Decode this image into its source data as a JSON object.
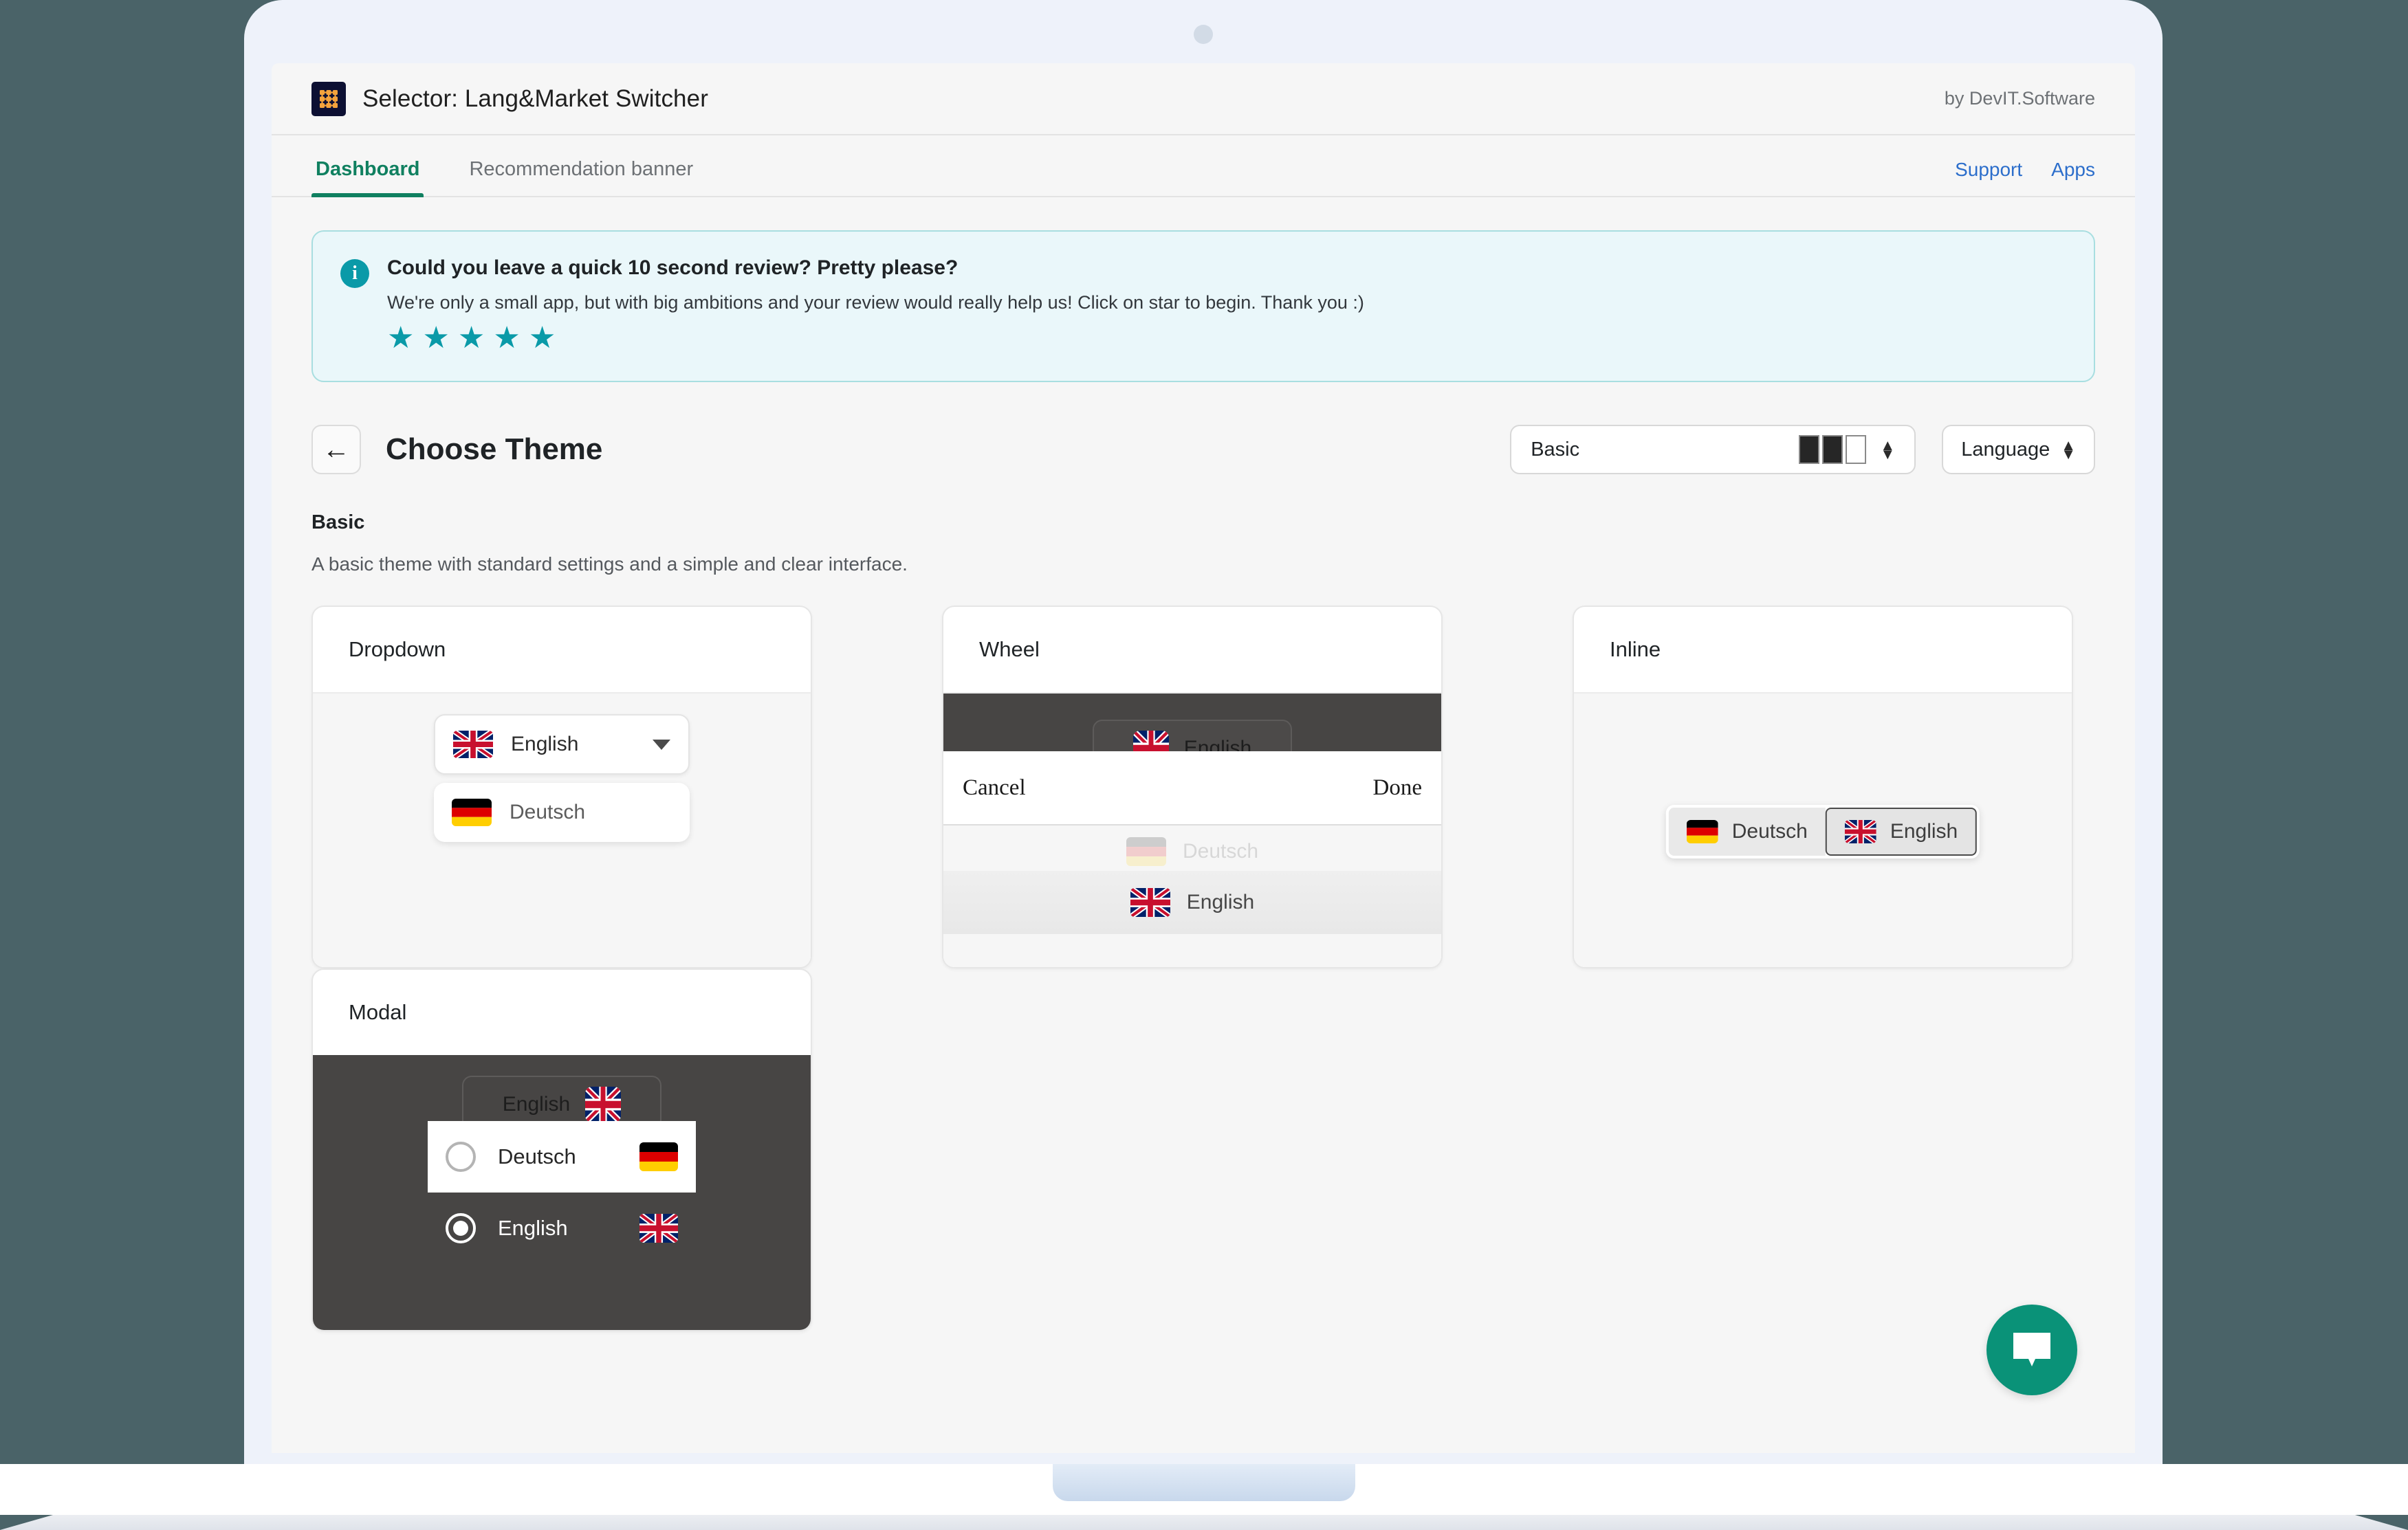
{
  "app": {
    "logo_icon": "grid-dots-icon",
    "title": "Selector: Lang&Market Switcher",
    "vendor": "by DevIT.Software"
  },
  "nav": {
    "tabs": [
      {
        "label": "Dashboard",
        "active": true
      },
      {
        "label": "Recommendation banner",
        "active": false
      }
    ],
    "links": [
      {
        "label": "Support"
      },
      {
        "label": "Apps"
      }
    ]
  },
  "review_banner": {
    "icon": "info-icon",
    "icon_glyph": "i",
    "title": "Could you leave a quick 10 second review? Pretty please?",
    "body": "We're only a small app, but with big ambitions and your review would really help us! Click on star to begin. Thank you :)",
    "stars": [
      "★",
      "★",
      "★",
      "★",
      "★"
    ],
    "star_color": "#0a9aa8"
  },
  "theme_header": {
    "back_icon": "arrow-left-icon",
    "back_glyph": "←",
    "title": "Choose Theme",
    "theme_select": {
      "value": "Basic",
      "swatches": [
        "#262626",
        "#262626",
        "#ffffff"
      ],
      "spinner_up": "▲",
      "spinner_down": "▼"
    },
    "language_select": {
      "value": "Language",
      "spinner_up": "▲",
      "spinner_down": "▼"
    }
  },
  "basic_section": {
    "name": "Basic",
    "description": "A basic theme with standard settings and a simple and clear interface."
  },
  "cards": {
    "dropdown": {
      "title": "Dropdown",
      "trigger_label": "English",
      "trigger_flag": "flag-uk",
      "caret_icon": "chevron-down-icon",
      "option_label": "Deutsch",
      "option_flag": "flag-de"
    },
    "wheel": {
      "title": "Wheel",
      "chip_label": "English",
      "chip_flag": "flag-uk",
      "cancel_label": "Cancel",
      "done_label": "Done",
      "item_de_label": "Deutsch",
      "item_de_flag": "flag-de",
      "item_en_label": "English",
      "item_en_flag": "flag-uk"
    },
    "inline": {
      "title": "Inline",
      "options": [
        {
          "label": "Deutsch",
          "flag": "flag-de",
          "selected": false
        },
        {
          "label": "English",
          "flag": "flag-uk",
          "selected": true
        }
      ]
    },
    "modal": {
      "title": "Modal",
      "trigger_label": "English",
      "trigger_flag": "flag-uk",
      "rows": [
        {
          "label": "Deutsch",
          "flag": "flag-de",
          "selected": false
        },
        {
          "label": "English",
          "flag": "flag-uk",
          "selected": true
        }
      ]
    }
  },
  "chat": {
    "icon": "chat-bubble-icon",
    "color": "#0a9278"
  }
}
